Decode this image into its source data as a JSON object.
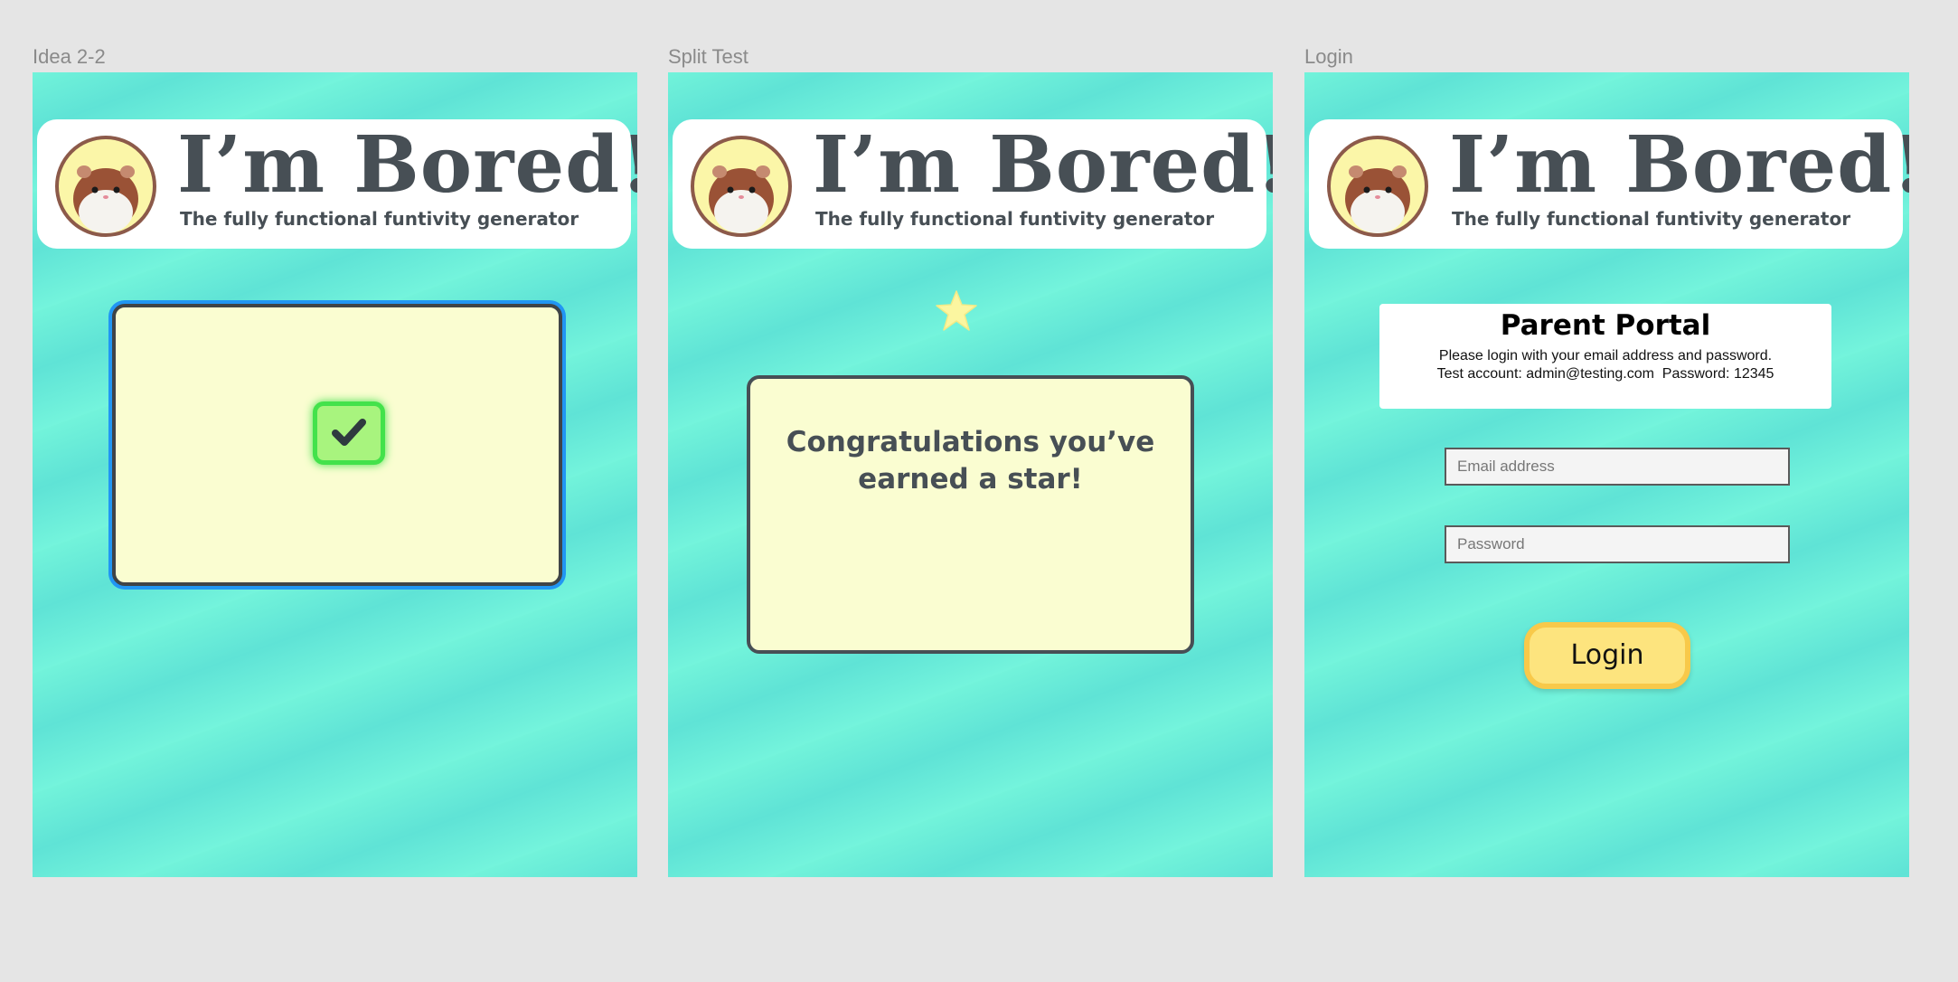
{
  "frames": [
    {
      "label": "Idea 2-2"
    },
    {
      "label": "Split Test"
    },
    {
      "label": "Login"
    }
  ],
  "header": {
    "title": "I’m Bored!",
    "subtitle": "The fully functional funtivity generator"
  },
  "split_test": {
    "message": "Congratulations you’ve earned a star!"
  },
  "login": {
    "portal_title": "Parent Portal",
    "instructions": "Please login with your email address and password.",
    "test_account": "Test account: admin@testing.com  Password: 12345",
    "email_placeholder": "Email address",
    "password_placeholder": "Password",
    "button_label": "Login"
  },
  "colors": {
    "background": "#e5e5e5",
    "frame_teal": "#6cefd9",
    "card_cream": "#fafdd1",
    "text_dark": "#474f55",
    "check_green": "#43e24b",
    "selection_blue": "#2196f3",
    "star_yellow": "#fbf6a0",
    "button_yellow": "#fde47e"
  },
  "icons": [
    "hamster-avatar-icon",
    "checkmark-icon",
    "star-icon"
  ]
}
